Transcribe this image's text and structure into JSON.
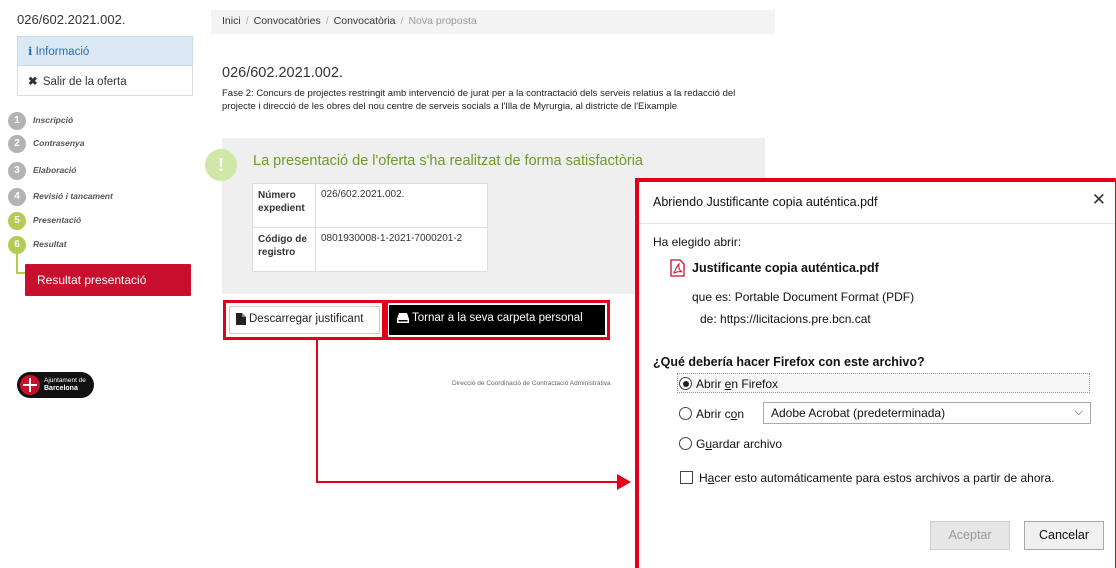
{
  "sidebar": {
    "code": "026/602.2021.002.",
    "info_label": "Informació",
    "exit_label": "Salir de la oferta",
    "steps": [
      {
        "num": "1",
        "label": "Inscripció"
      },
      {
        "num": "2",
        "label": "Contrasenya"
      },
      {
        "num": "3",
        "label": "Elaboració"
      },
      {
        "num": "4",
        "label": "Revisió i tancament"
      },
      {
        "num": "5",
        "label": "Presentació"
      },
      {
        "num": "6",
        "label": "Resultat"
      }
    ],
    "result_button": "Resultat presentació",
    "logo": {
      "line1": "Ajuntament de",
      "line2": "Barcelona"
    }
  },
  "breadcrumb": {
    "items": [
      "Inici",
      "Convocatòries",
      "Convocatòria"
    ],
    "current": "Nova proposta"
  },
  "main": {
    "title": "026/602.2021.002.",
    "description": "Fase 2: Concurs de projectes restringit amb intervenció de jurat per a la contractació dels serveis relatius a la redacció del projecte i direcció de les obres del nou centre de serveis socials a l'Illa de Myrurgia, al districte de l'Eixample",
    "success_message": "La presentació de l'oferta s'ha realitzat de forma satisfactòria",
    "table": [
      {
        "key": "Número expedient",
        "value": "026/602.2021.002."
      },
      {
        "key": "Código de registro",
        "value": "0801930008-1-2021-7000201-2"
      }
    ],
    "download_button": "Descarregar justificant",
    "back_button": "Tornar a la seva carpeta personal",
    "footer_note": "Direcció de Coordinació de Contractació Administrativa"
  },
  "dialog": {
    "title": "Abriendo Justificante copia auténtica.pdf",
    "chosen_label": "Ha elegido abrir:",
    "filename": "Justificante copia auténtica.pdf",
    "type_label": "que es:",
    "type_value": "Portable Document Format (PDF)",
    "from_label": "de:",
    "from_value": "https://licitacions.pre.bcn.cat",
    "question": "¿Qué debería hacer Firefox con este archivo?",
    "opt_open_firefox_a": "Abrir ",
    "opt_open_firefox_u": "e",
    "opt_open_firefox_b": "n Firefox",
    "opt_open_with_a": "Abrir c",
    "opt_open_with_u": "o",
    "opt_open_with_b": "n",
    "open_with_app": "Adobe Acrobat (predeterminada)",
    "opt_save_a": "G",
    "opt_save_u": "u",
    "opt_save_b": "ardar archivo",
    "auto_a": "H",
    "auto_u": "a",
    "auto_b": "cer esto automáticamente para estos archivos a partir de ahora.",
    "ok_button": "Aceptar",
    "cancel_button": "Cancelar"
  },
  "colors": {
    "accent_red": "#e0001a",
    "result_red": "#c8102e",
    "success_green": "#6e9a2c"
  }
}
